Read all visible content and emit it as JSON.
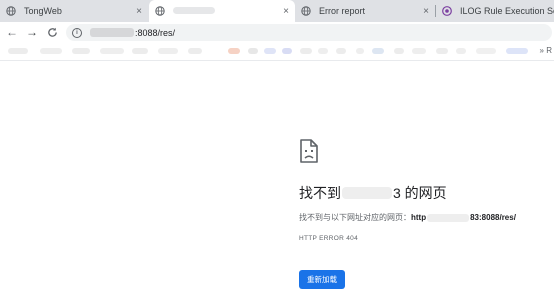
{
  "tabs": [
    {
      "title": "TongWeb",
      "close": "×",
      "favicon": "globe-icon"
    },
    {
      "title": "",
      "close": "×",
      "favicon": "globe-icon",
      "active": true
    },
    {
      "title": "Error report",
      "close": "×",
      "favicon": "globe-icon"
    },
    {
      "title": "ILOG Rule Execution Server",
      "close": "",
      "favicon": "ilog-logo-icon"
    }
  ],
  "toolbar": {
    "back_icon": "←",
    "forward_icon": "→",
    "reload_icon": "C",
    "info_icon": "i",
    "url_visible": ":8088/res/"
  },
  "bookmarks": {
    "more": "» R"
  },
  "error": {
    "icon": "sad-document-icon",
    "title_prefix": "找不到 ",
    "title_suffix": "3 的网页",
    "desc_prefix": "找不到与以下网址对应的网页：",
    "url_start": "http",
    "url_end": "83:8088/res/",
    "code": "HTTP ERROR 404",
    "reload_button": "重新加载"
  },
  "colors": {
    "accent": "#1a73e8",
    "tabstrip": "#dfe1e5",
    "omnibox": "#f1f3f4"
  }
}
